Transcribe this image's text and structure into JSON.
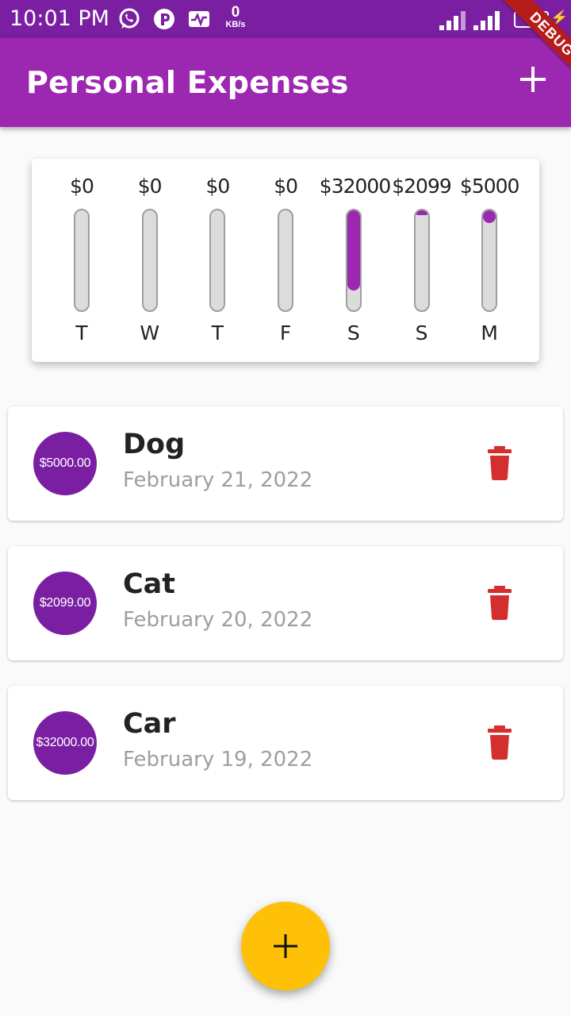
{
  "status_bar": {
    "time": "10:01 PM",
    "net_speed_value": "0",
    "net_speed_unit": "KB/s",
    "battery": "77",
    "icons": [
      "whatsapp-icon",
      "p-app-icon",
      "activity-icon",
      "signal-icon",
      "signal-icon",
      "battery-icon",
      "charging-icon"
    ]
  },
  "debug_banner": "DEBUG",
  "app_bar": {
    "title": "Personal Expenses",
    "action_icon": "plus-icon"
  },
  "colors": {
    "primary": "#9c27b0",
    "primary_dark": "#7b1fa2",
    "accent": "#ffc107",
    "delete": "#d32f2f",
    "bar_track": "#dcdcdc"
  },
  "chart": {
    "bars": [
      {
        "day": "T",
        "amount": "$0",
        "fraction": 0
      },
      {
        "day": "W",
        "amount": "$0",
        "fraction": 0
      },
      {
        "day": "T",
        "amount": "$0",
        "fraction": 0
      },
      {
        "day": "F",
        "amount": "$0",
        "fraction": 0
      },
      {
        "day": "S",
        "amount": "$32000",
        "fraction": 0.8
      },
      {
        "day": "S",
        "amount": "$2099",
        "fraction": 0.05
      },
      {
        "day": "M",
        "amount": "$5000",
        "fraction": 0.13
      }
    ]
  },
  "transactions": [
    {
      "amount": "$5000.00",
      "title": "Dog",
      "date": "February 21, 2022"
    },
    {
      "amount": "$2099.00",
      "title": "Cat",
      "date": "February 20, 2022"
    },
    {
      "amount": "$32000.00",
      "title": "Car",
      "date": "February 19, 2022"
    }
  ],
  "fab_icon": "plus-icon"
}
